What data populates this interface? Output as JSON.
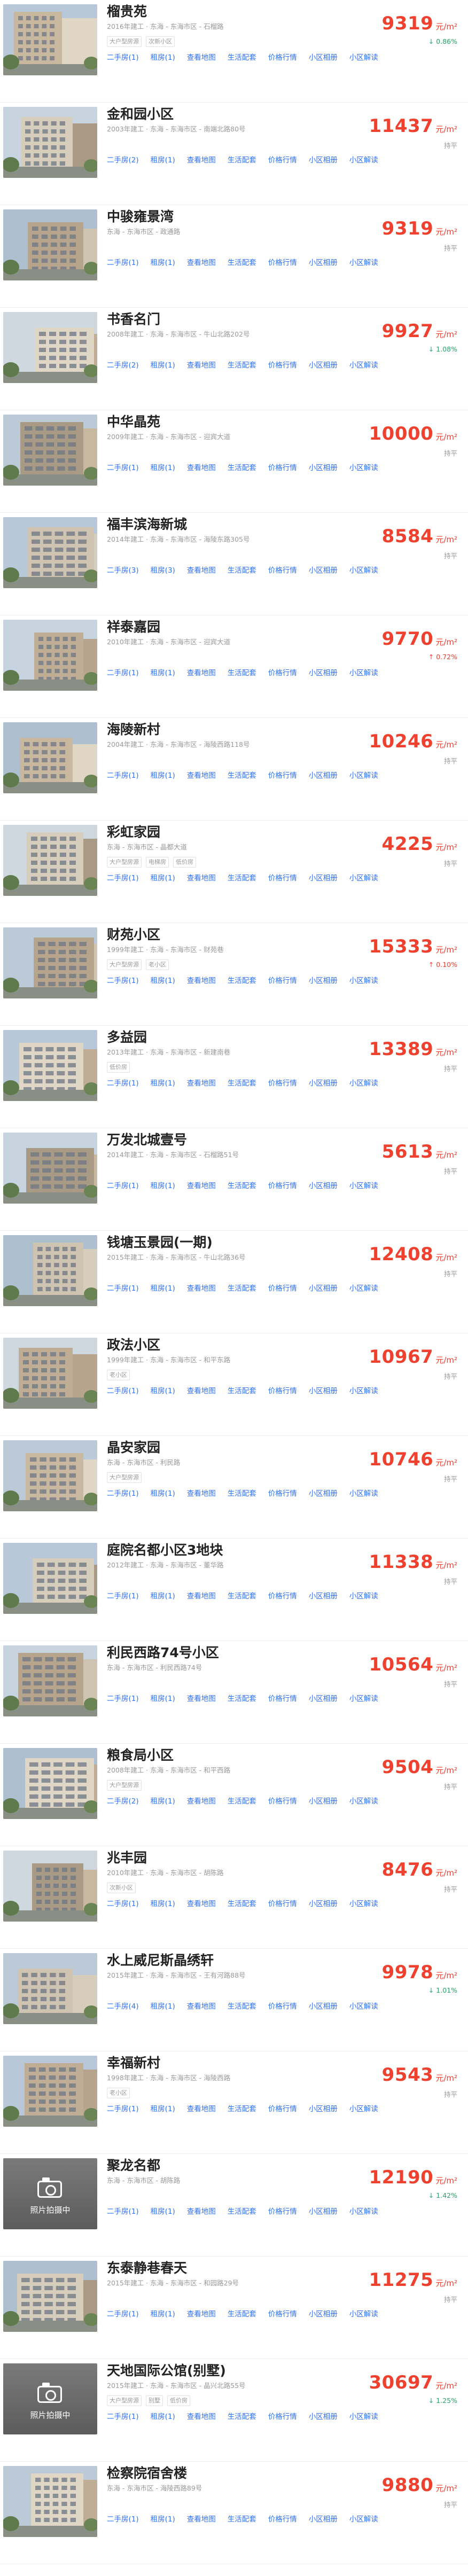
{
  "colors": {
    "price": "#f0412f",
    "up": "#f0412f",
    "down": "#29a36a",
    "link": "#3072f6"
  },
  "price_unit": "元/m²",
  "links": [
    "二手房",
    "租房",
    "查看地图",
    "生活配套",
    "价格行情",
    "小区相册",
    "小区解读"
  ],
  "items": [
    {
      "name": "榴贵苑",
      "meta": "2016年建工 · 东海 - 东海市区 - 石榴路",
      "tags": [
        "大户型房源",
        "次新小区"
      ],
      "price": "9319",
      "change": "↓ 0.86%",
      "trend": "down",
      "counts": [
        "1",
        "1"
      ]
    },
    {
      "name": "金和园小区",
      "meta": "2003年建工 · 东海 - 东海市区 - 南端北路80号",
      "tags": [],
      "price": "11437",
      "change": "持平",
      "trend": "flat",
      "counts": [
        "2",
        "1"
      ]
    },
    {
      "name": "中骏雍景湾",
      "meta": "东海 - 东海市区 - 政通路",
      "tags": [],
      "price": "9319",
      "change": "持平",
      "trend": "flat",
      "counts": [
        "1",
        "1"
      ]
    },
    {
      "name": "书香名门",
      "meta": "2008年建工 · 东海 - 东海市区 - 牛山北路202号",
      "tags": [],
      "price": "9927",
      "change": "↓ 1.08%",
      "trend": "down",
      "counts": [
        "2",
        "1"
      ]
    },
    {
      "name": "中华晶苑",
      "meta": "2009年建工 · 东海 - 东海市区 - 迎宾大道",
      "tags": [],
      "price": "10000",
      "change": "持平",
      "trend": "flat",
      "counts": [
        "1",
        "1"
      ]
    },
    {
      "name": "福丰滨海新城",
      "meta": "2014年建工 · 东海 - 东海市区 - 海陵东路305号",
      "tags": [],
      "price": "8584",
      "change": "持平",
      "trend": "flat",
      "counts": [
        "3",
        "3"
      ]
    },
    {
      "name": "祥泰嘉园",
      "meta": "2010年建工 · 东海 - 东海市区 - 迎宾大道",
      "tags": [],
      "price": "9770",
      "change": "↑ 0.72%",
      "trend": "up",
      "counts": [
        "1",
        "1"
      ]
    },
    {
      "name": "海陵新村",
      "meta": "2004年建工 · 东海 - 东海市区 - 海陵西路118号",
      "tags": [],
      "price": "10246",
      "change": "持平",
      "trend": "flat",
      "counts": [
        "1",
        "1"
      ]
    },
    {
      "name": "彩虹家园",
      "meta": "东海 - 东海市区 - 晶都大道",
      "tags": [
        "大户型房源",
        "电梯房",
        "低价房"
      ],
      "price": "4225",
      "change": "持平",
      "trend": "flat",
      "counts": [
        "1",
        "1"
      ]
    },
    {
      "name": "财苑小区",
      "meta": "1999年建工 · 东海 - 东海市区 - 财苑巷",
      "tags": [
        "大户型房源",
        "老小区"
      ],
      "price": "15333",
      "change": "↑ 0.10%",
      "trend": "up",
      "counts": [
        "1",
        "1"
      ]
    },
    {
      "name": "多益园",
      "meta": "2013年建工 · 东海 - 东海市区 - 新建南巷",
      "tags": [
        "低价房"
      ],
      "price": "13389",
      "change": "持平",
      "trend": "flat",
      "counts": [
        "1",
        "1"
      ]
    },
    {
      "name": "万发北城壹号",
      "meta": "2014年建工 · 东海 - 东海市区 - 石榴路51号",
      "tags": [],
      "price": "5613",
      "change": "持平",
      "trend": "flat",
      "counts": [
        "1",
        "1"
      ]
    },
    {
      "name": "钱塘玉景园(一期)",
      "meta": "2015年建工 · 东海 - 东海市区 - 牛山北路36号",
      "tags": [],
      "price": "12408",
      "change": "持平",
      "trend": "flat",
      "counts": [
        "1",
        "1"
      ]
    },
    {
      "name": "政法小区",
      "meta": "1999年建工 · 东海 - 东海市区 - 和平东路",
      "tags": [
        "老小区"
      ],
      "price": "10967",
      "change": "持平",
      "trend": "flat",
      "counts": [
        "1",
        "1"
      ]
    },
    {
      "name": "晶安家园",
      "meta": "东海 - 东海市区 - 利民路",
      "tags": [
        "大户型房源"
      ],
      "price": "10746",
      "change": "持平",
      "trend": "flat",
      "counts": [
        "1",
        "1"
      ]
    },
    {
      "name": "庭院名都小区3地块",
      "meta": "2012年建工 · 东海 - 东海市区 - 董华路",
      "tags": [],
      "price": "11338",
      "change": "持平",
      "trend": "flat",
      "counts": [
        "1",
        "1"
      ]
    },
    {
      "name": "利民西路74号小区",
      "meta": "东海 - 东海市区 - 利民西路74号",
      "tags": [],
      "price": "10564",
      "change": "持平",
      "trend": "flat",
      "counts": [
        "1",
        "1"
      ]
    },
    {
      "name": "粮食局小区",
      "meta": "2008年建工 · 东海 - 东海市区 - 和平西路",
      "tags": [
        "大户型房源"
      ],
      "price": "9504",
      "change": "持平",
      "trend": "flat",
      "counts": [
        "2",
        "1"
      ]
    },
    {
      "name": "兆丰园",
      "meta": "2010年建工 · 东海 - 东海市区 - 胡陈路",
      "tags": [
        "次新小区"
      ],
      "price": "8476",
      "change": "持平",
      "trend": "flat",
      "counts": [
        "1",
        "1"
      ]
    },
    {
      "name": "水上威尼斯晶绣轩",
      "meta": "2015年建工 · 东海 - 东海市区 - 王有河路88号",
      "tags": [],
      "price": "9978",
      "change": "↓ 1.01%",
      "trend": "down",
      "counts": [
        "4",
        "1"
      ]
    },
    {
      "name": "幸福新村",
      "meta": "1998年建工 · 东海 - 东海市区 - 海陵西路",
      "tags": [
        "老小区"
      ],
      "price": "9543",
      "change": "持平",
      "trend": "flat",
      "counts": [
        "1",
        "1"
      ]
    },
    {
      "name": "聚龙名都",
      "meta": "东海 - 东海市区 - 胡陈路",
      "tags": [],
      "price": "12190",
      "change": "↓ 1.42%",
      "trend": "down",
      "counts": [
        "1",
        "1"
      ],
      "placeholder": "照片拍摄中"
    },
    {
      "name": "东泰静巷春天",
      "meta": "2015年建工 · 东海 - 东海市区 - 和园路29号",
      "tags": [],
      "price": "11275",
      "change": "持平",
      "trend": "flat",
      "counts": [
        "1",
        "1"
      ]
    },
    {
      "name": "天地国际公馆(别墅)",
      "meta": "2015年建工 · 东海 - 东海市区 - 晶兴北路55号",
      "tags": [
        "大户型房源",
        "别墅",
        "低价房"
      ],
      "price": "30697",
      "change": "↓ 1.25%",
      "trend": "down",
      "counts": [
        "1",
        "1"
      ],
      "placeholder": "照片拍摄中"
    },
    {
      "name": "检察院宿舍楼",
      "meta": "东海 - 东海市区 - 海陵西路89号",
      "tags": [],
      "price": "9880",
      "change": "持平",
      "trend": "flat",
      "counts": [
        "1",
        "1"
      ]
    }
  ]
}
